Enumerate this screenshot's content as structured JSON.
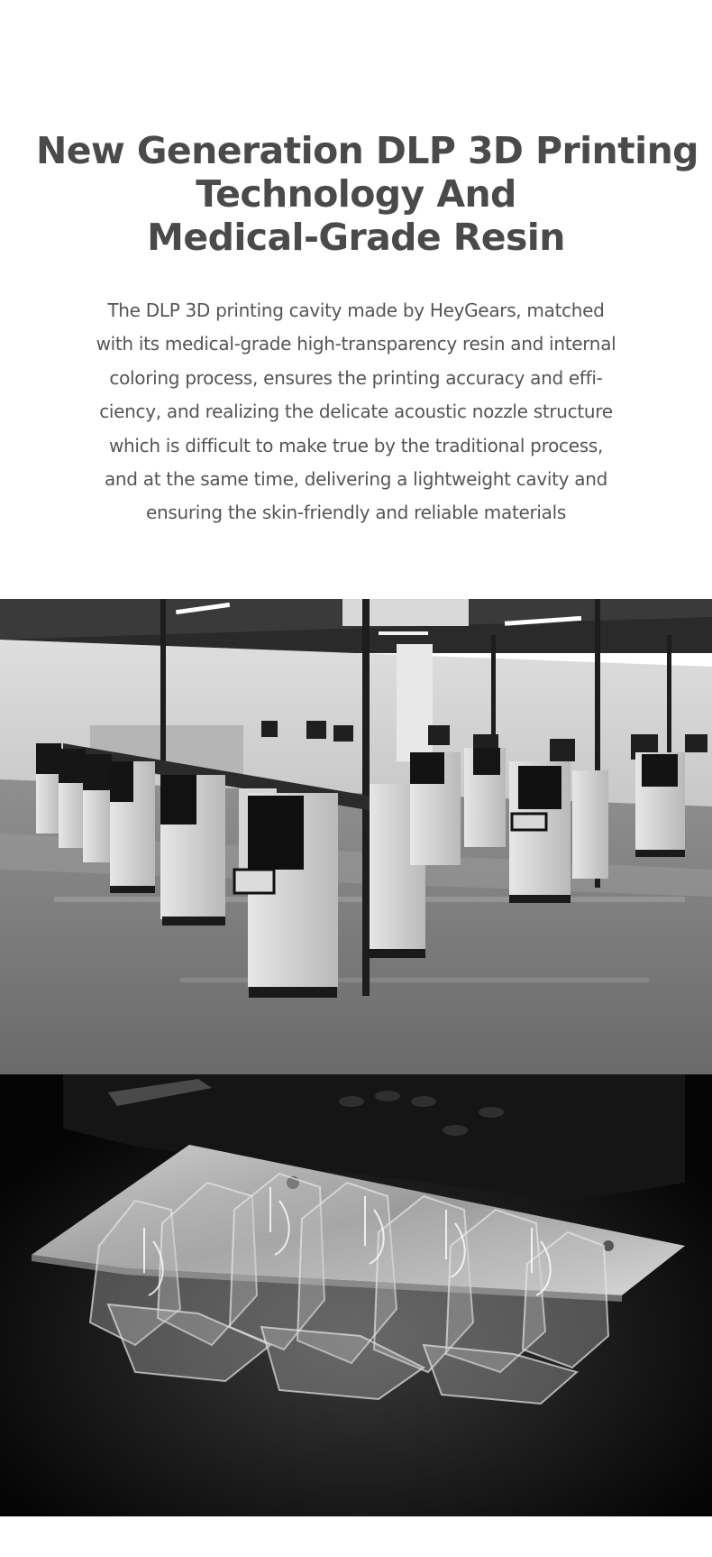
{
  "heading": {
    "lines": [
      "New Generation DLP 3D Printing",
      "Technology And",
      "Medical-Grade Resin"
    ]
  },
  "description": {
    "lines": [
      "The DLP 3D printing cavity made by HeyGears, matched",
      "with its medical-grade high-transparency resin and internal",
      "coloring process, ensures the printing accuracy and effi-",
      "ciency, and realizing the delicate acoustic nozzle structure",
      "which is difficult to make true by the traditional process,",
      "and at the same time, delivering a lightweight cavity and",
      "ensuring the skin-friendly and reliable materials"
    ]
  }
}
